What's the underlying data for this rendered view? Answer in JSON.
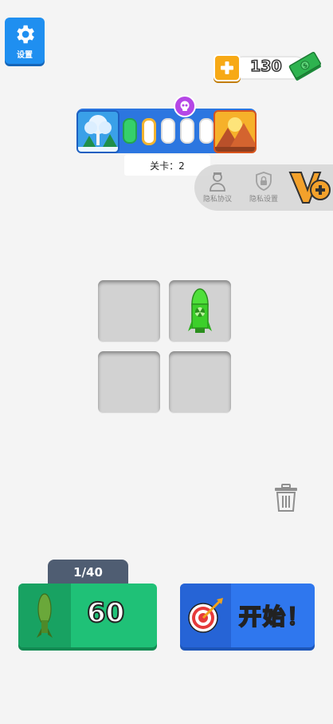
{
  "settings": {
    "label": "设置"
  },
  "currency": {
    "amount": "130"
  },
  "level": {
    "label": "关卡：2",
    "stages": [
      "done",
      "current",
      "locked",
      "locked",
      "locked"
    ]
  },
  "privacy": {
    "items": [
      {
        "label": "隐私协议"
      },
      {
        "label": "隐私设置"
      }
    ]
  },
  "grid": {
    "cells": [
      {
        "item": null
      },
      {
        "item": "green-rocket"
      },
      {
        "item": null
      },
      {
        "item": null
      }
    ]
  },
  "counter": {
    "text": "1/40"
  },
  "buy": {
    "price": "60"
  },
  "start": {
    "label": "开始！"
  },
  "colors": {
    "settings_blue": "#1f8ff0",
    "level_blue": "#2c76e0",
    "buy_green": "#1fc177",
    "start_blue": "#2f77ee",
    "progress_done": "#35d06a",
    "progress_current": "#f2b431"
  }
}
